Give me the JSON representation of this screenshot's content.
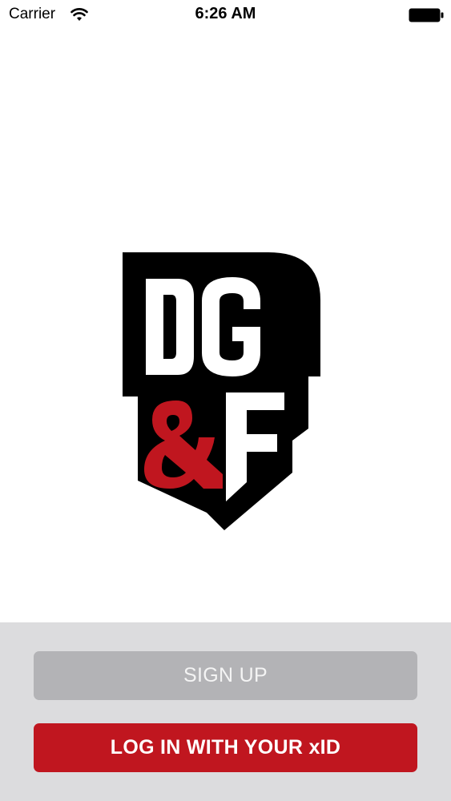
{
  "status_bar": {
    "carrier": "Carrier",
    "time": "6:26 AM",
    "wifi_icon": "wifi-icon",
    "battery_icon": "battery-full-icon"
  },
  "logo": {
    "text": "DG&F",
    "colors": {
      "outline": "#000000",
      "letters": "#ffffff",
      "ampersand": "#c0161f"
    }
  },
  "actions": {
    "sign_up_label": "SIGN UP",
    "login_label": "LOG IN WITH YOUR xID"
  },
  "colors": {
    "background": "#ffffff",
    "panel": "#dcdcde",
    "sign_up_button": "#b3b3b6",
    "login_button": "#c0161f"
  }
}
